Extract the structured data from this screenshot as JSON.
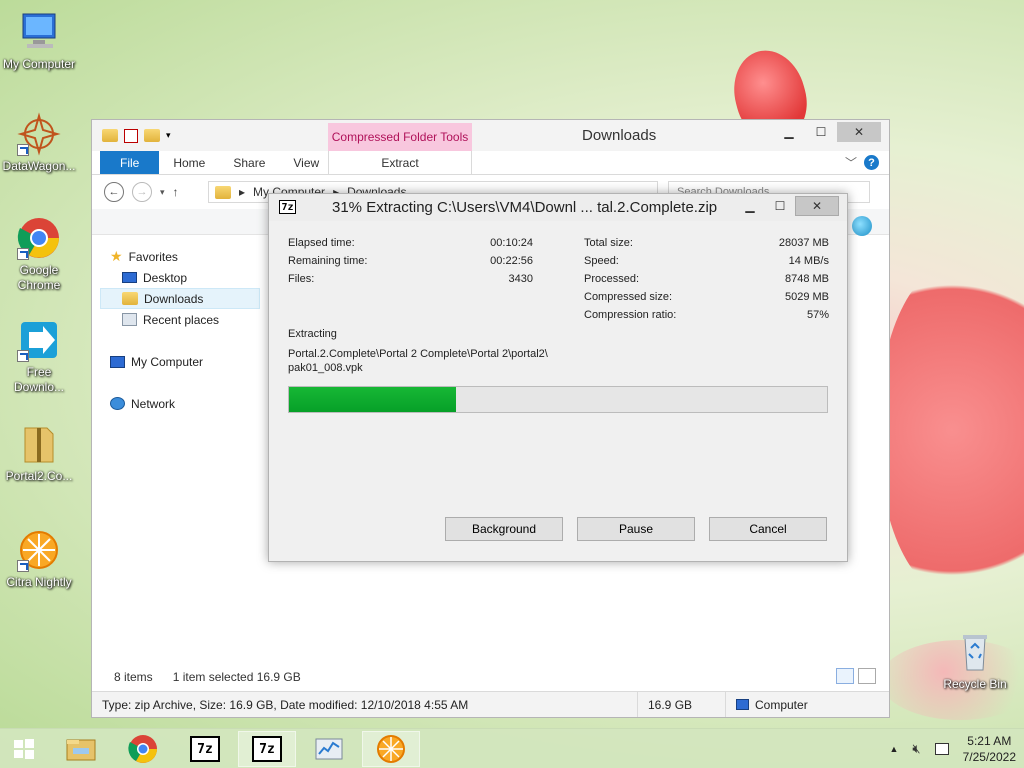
{
  "desktop": {
    "icons": [
      {
        "name": "my-computer",
        "label": "My Computer"
      },
      {
        "name": "datawagon",
        "label": "DataWagon..."
      },
      {
        "name": "google-chrome",
        "label": "Google Chrome"
      },
      {
        "name": "free-downloader",
        "label": "Free Downlo..."
      },
      {
        "name": "portal2-folder",
        "label": "Portal2.Co..."
      },
      {
        "name": "citra-nightly",
        "label": "Citra Nightly"
      },
      {
        "name": "recycle-bin",
        "label": "Recycle Bin"
      }
    ]
  },
  "explorer": {
    "title": "Downloads",
    "context_tab": "Compressed Folder Tools",
    "ribbon_tabs": [
      "File",
      "Home",
      "Share",
      "View"
    ],
    "extract_tab": "Extract",
    "address": {
      "root": "My Computer",
      "current": "Downloads"
    },
    "search_placeholder": "Search Downloads",
    "nav": {
      "favorites": "Favorites",
      "desktop": "Desktop",
      "downloads": "Downloads",
      "recent": "Recent places",
      "computer": "My Computer",
      "network": "Network"
    },
    "status": {
      "items": "8 items",
      "selected": "1 item selected  16.9 GB",
      "details": "Type: zip Archive, Size: 16.9 GB, Date modified: 12/10/2018 4:55 AM",
      "size": "16.9 GB",
      "location": "Computer"
    }
  },
  "dialog": {
    "title": "31% Extracting C:\\Users\\VM4\\Downl ... tal.2.Complete.zip",
    "icon_text": "7z",
    "left_stats": [
      {
        "label": "Elapsed time:",
        "value": "00:10:24"
      },
      {
        "label": "Remaining time:",
        "value": "00:22:56"
      },
      {
        "label": "Files:",
        "value": "3430"
      }
    ],
    "right_stats": [
      {
        "label": "Total size:",
        "value": "28037 MB"
      },
      {
        "label": "Speed:",
        "value": "14 MB/s"
      },
      {
        "label": "Processed:",
        "value": "8748 MB"
      },
      {
        "label": "Compressed size:",
        "value": "5029 MB"
      },
      {
        "label": "Compression ratio:",
        "value": "57%"
      }
    ],
    "action": "Extracting",
    "path_line1": "Portal.2.Complete\\Portal 2 Complete\\Portal 2\\portal2\\",
    "path_line2": "pak01_008.vpk",
    "progress": 0.31,
    "buttons": {
      "background": "Background",
      "pause": "Pause",
      "cancel": "Cancel"
    }
  },
  "taskbar": {
    "items": [
      "file-explorer",
      "google-chrome",
      "7zip",
      "7zip-active",
      "task-manager",
      "citra"
    ],
    "time": "5:21 AM",
    "date": "7/25/2022"
  }
}
